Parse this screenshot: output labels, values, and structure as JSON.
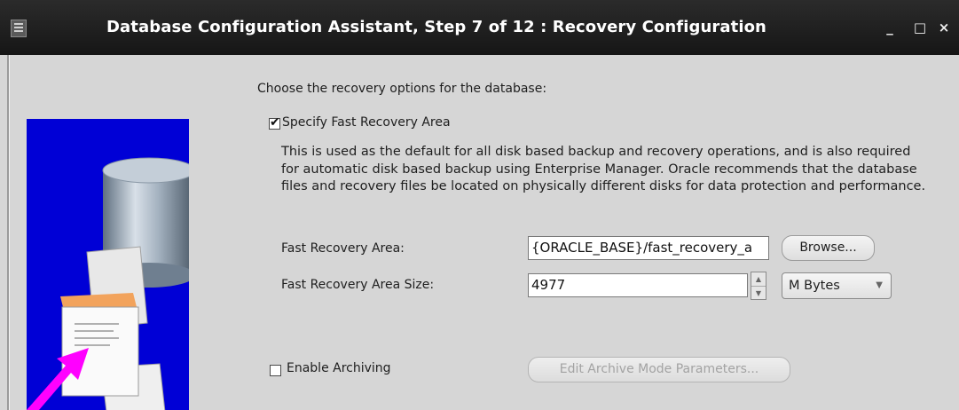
{
  "window": {
    "title": "Database Configuration Assistant, Step 7 of 12 : Recovery Configuration",
    "controls": {
      "minimize": "_",
      "maximize": "□",
      "close": "×"
    }
  },
  "main": {
    "intro": "Choose the recovery options for the database:",
    "specify_fra": {
      "label": "Specify Fast Recovery Area",
      "checked": true,
      "check_glyph": "✔"
    },
    "description": "This is used as the default for all disk based backup and recovery operations, and is also required for automatic disk based backup using Enterprise Manager. Oracle recommends that the database files and recovery files be located on physically different disks for data protection and performance.",
    "fra_location": {
      "label": "Fast Recovery Area:",
      "value": "{ORACLE_BASE}/fast_recovery_a",
      "browse_label": "Browse..."
    },
    "fra_size": {
      "label": "Fast Recovery Area Size:",
      "value": "4977",
      "unit": "M Bytes",
      "up_glyph": "▲",
      "down_glyph": "▼",
      "dropdown_glyph": "▼"
    },
    "archiving": {
      "label": "Enable Archiving",
      "checked": false,
      "edit_params_label": "Edit Archive Mode Parameters..."
    }
  },
  "colors": {
    "title_bar": "#1f1f1f",
    "background": "#d6d6d6",
    "illustration_blue": "#0000d6",
    "arrow_magenta": "#ff00ff",
    "folder_orange": "#f2a35c"
  }
}
